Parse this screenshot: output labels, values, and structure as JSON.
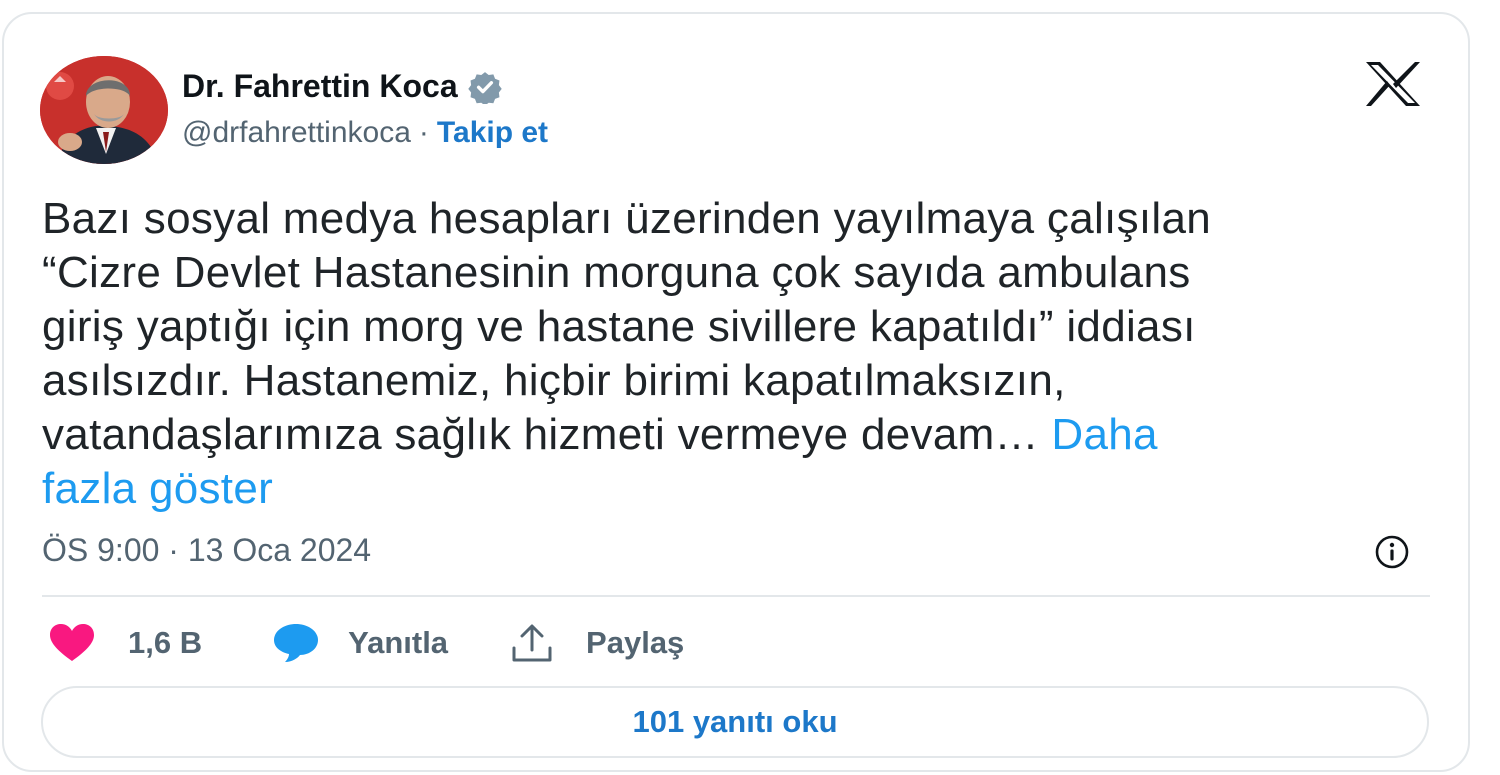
{
  "author": {
    "name": "Dr. Fahrettin Koca",
    "handle": "@drfahrettinkoca",
    "separator": "·",
    "follow_label": "Takip et"
  },
  "tweet": {
    "lines": [
      "Bazı sosyal medya hesapları üzerinden yayılmaya çalışılan",
      "“Cizre Devlet Hastanesinin morguna çok sayıda ambulans",
      "giriş yaptığı için morg ve hastane sivillere kapatıldı” iddiası",
      "asılsızdır. Hastanemiz, hiçbir birimi kapatılmaksızın,",
      "vatandaşlarımıza sağlık hizmeti vermeye devam… "
    ],
    "show_more_part1": "Daha",
    "show_more_part2": "fazla göster",
    "timestamp": "ÖS 9:00 · 13 Oca 2024"
  },
  "actions": {
    "like_count": "1,6 B",
    "reply_label": "Yanıtla",
    "share_label": "Paylaş"
  },
  "replies_button_label": "101 yanıtı oku",
  "colors": {
    "like": "#f91880",
    "reply": "#1d9bf0",
    "link": "#1d9bf0",
    "follow": "#1d78c9",
    "text": "#0f1419",
    "muted": "#536471"
  },
  "icons": {
    "verified": "verified-badge-icon",
    "brand": "x-logo-icon",
    "info": "info-icon",
    "like": "heart-icon",
    "reply": "speech-bubble-icon",
    "share": "share-upload-icon"
  }
}
